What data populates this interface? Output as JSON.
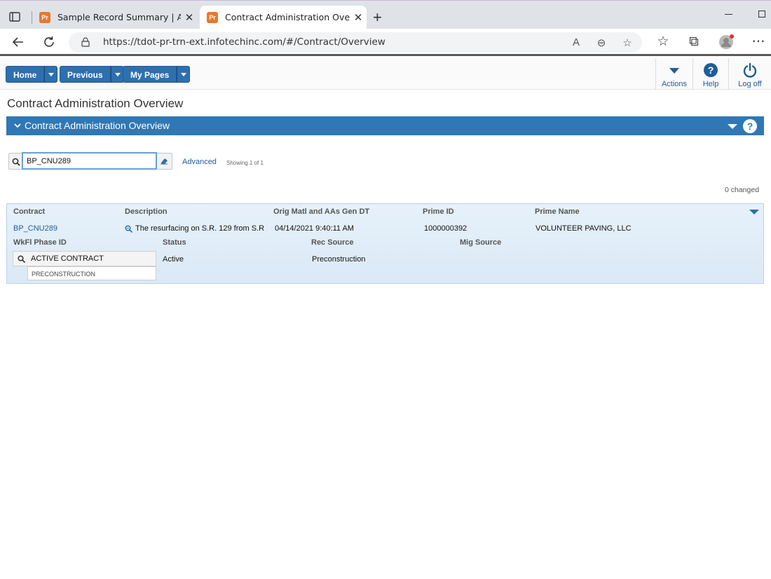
{
  "browser": {
    "tabs": [
      {
        "favicon": "Pr",
        "title": "Sample Record Summary | AASHT"
      },
      {
        "favicon": "Pr",
        "title": "Contract Administration Overview"
      }
    ],
    "url": "https://tdot-pr-trn-ext.infotechinc.com/#/Contract/Overview"
  },
  "toolbar": {
    "home_label": "Home",
    "previous_label": "Previous",
    "mypages_label": "My Pages",
    "actions_label": "Actions",
    "help_label": "Help",
    "logoff_label": "Log off"
  },
  "page": {
    "title": "Contract Administration Overview",
    "panel_title": "Contract Administration Overview"
  },
  "search": {
    "value": "BP_CNU289",
    "advanced_label": "Advanced",
    "showing": "Showing 1 of 1",
    "changed": "0 changed"
  },
  "grid": {
    "headers": {
      "contract": "Contract",
      "description": "Description",
      "orig_matl": "Orig Matl and AAs Gen DT",
      "prime_id": "Prime ID",
      "prime_name": "Prime Name",
      "wkfl_phase": "WkFl Phase ID",
      "status": "Status",
      "rec_source": "Rec Source",
      "mig_source": "Mig Source"
    },
    "row": {
      "contract": "BP_CNU289",
      "description": "The resurfacing on S.R. 129 from S.R",
      "orig_matl": "04/14/2021 9:40:11 AM",
      "prime_id": "1000000392",
      "prime_name": "VOLUNTEER PAVING, LLC",
      "wkfl_phase": "ACTIVE CONTRACT",
      "wkfl_phase_sub": "PRECONSTRUCTION",
      "status": "Active",
      "rec_source": "Preconstruction",
      "mig_source": ""
    }
  }
}
